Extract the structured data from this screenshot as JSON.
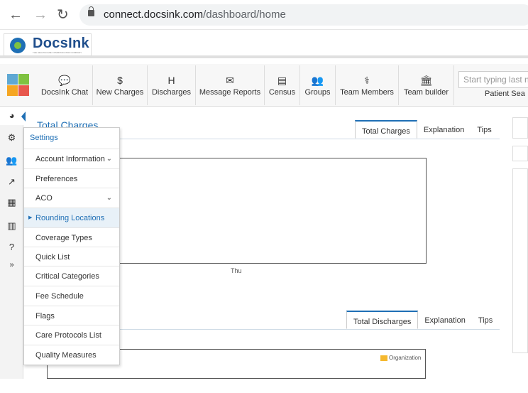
{
  "browser": {
    "url_host": "connect.docsink.com",
    "url_path": "/dashboard/home",
    "back_icon": "←",
    "forward_icon": "→",
    "reload_icon": "↻"
  },
  "logo": {
    "text": "DocsInk",
    "tagline": "THE HEALTHCARE COMMUNICATION COMPANY"
  },
  "app_grid_colors": [
    "#5fa8d3",
    "#7fc241",
    "#f5a623",
    "#e8574d"
  ],
  "toolbar": {
    "items": [
      {
        "label": "DocsInk Chat",
        "icon": "chat-icon"
      },
      {
        "label": "New Charges",
        "icon": "dollar-icon"
      },
      {
        "label": "Discharges",
        "icon": "hospital-icon"
      },
      {
        "label": "Message Reports",
        "icon": "envelope-icon"
      },
      {
        "label": "Census",
        "icon": "list-icon"
      },
      {
        "label": "Groups",
        "icon": "users-icon"
      },
      {
        "label": "Team Members",
        "icon": "doctor-icon"
      },
      {
        "label": "Team builder",
        "icon": "institution-icon"
      }
    ],
    "glyphs": [
      "💬",
      "$",
      "H",
      "✉",
      "▤",
      "👥",
      "⚕",
      "🏛"
    ],
    "search_placeholder": "Start typing last n",
    "search_label": "Patient Sea"
  },
  "rail": {
    "icons": [
      "dashboard-icon",
      "settings-icon",
      "users-icon",
      "share-icon",
      "table-icon",
      "calendar-icon",
      "help-icon",
      "expand-icon"
    ],
    "glyphs": [
      "◕",
      "⚙",
      "👥",
      "↗",
      "▦",
      "▥",
      "?",
      "»"
    ]
  },
  "panel1": {
    "title": "Total Charges",
    "tabs": [
      "Total Charges",
      "Explanation",
      "Tips"
    ],
    "x_tick": "Thu"
  },
  "panel2": {
    "tabs": [
      "Total Discharges",
      "Explanation",
      "Tips"
    ],
    "legend": "Organization",
    "legend_color": "#f5b82e"
  },
  "settings_menu": {
    "header": "Settings",
    "items": [
      {
        "label": "Account Information",
        "chevron": "⌄"
      },
      {
        "label": "Preferences"
      },
      {
        "label": "ACO",
        "chevron": "⌄"
      },
      {
        "label": "Rounding Locations",
        "active": true
      },
      {
        "label": "Coverage Types"
      },
      {
        "label": "Quick List"
      },
      {
        "label": "Critical Categories"
      },
      {
        "label": "Fee Schedule"
      },
      {
        "label": "Flags"
      },
      {
        "label": "Care Protocols List"
      },
      {
        "label": "Quality Measures"
      }
    ]
  },
  "colors": {
    "accent": "#1f6fb5",
    "active_bg": "#e8f1f8"
  }
}
